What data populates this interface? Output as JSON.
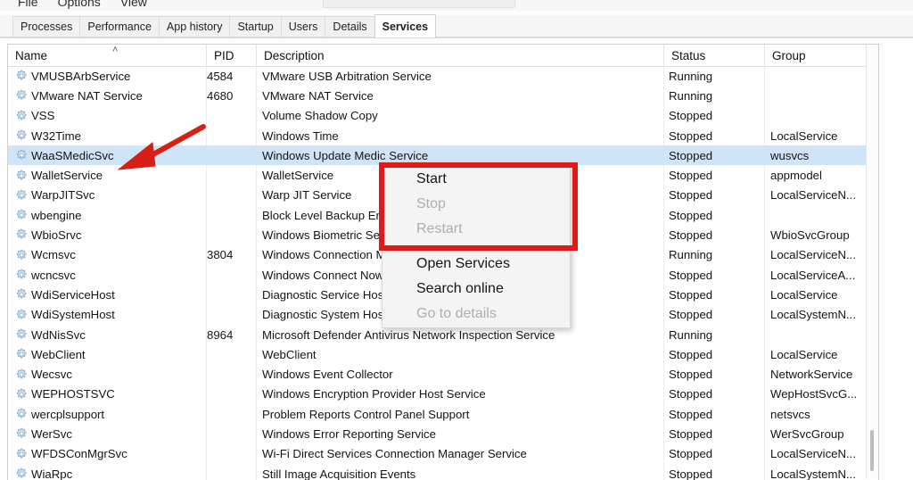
{
  "window": {
    "menubar": [
      "File",
      "Options",
      "View"
    ]
  },
  "tabs": [
    {
      "label": "Processes",
      "active": false
    },
    {
      "label": "Performance",
      "active": false
    },
    {
      "label": "App history",
      "active": false
    },
    {
      "label": "Startup",
      "active": false
    },
    {
      "label": "Users",
      "active": false
    },
    {
      "label": "Details",
      "active": false
    },
    {
      "label": "Services",
      "active": true
    }
  ],
  "columns": [
    {
      "key": "name",
      "label": "Name",
      "sorted": "asc"
    },
    {
      "key": "pid",
      "label": "PID"
    },
    {
      "key": "description",
      "label": "Description"
    },
    {
      "key": "status",
      "label": "Status"
    },
    {
      "key": "group",
      "label": "Group"
    }
  ],
  "icons": {
    "service": "gear-icon",
    "sort_ascending": "˄"
  },
  "colors": {
    "selection": "#cfe5f7",
    "annotation": "#e01b17",
    "disabled_text": "#aeaeae"
  },
  "rows": [
    {
      "name": "VMUSBArbService",
      "pid": "4584",
      "description": "VMware USB Arbitration Service",
      "status": "Running",
      "group": "",
      "selected": false
    },
    {
      "name": "VMware NAT Service",
      "pid": "4680",
      "description": "VMware NAT Service",
      "status": "Running",
      "group": "",
      "selected": false
    },
    {
      "name": "VSS",
      "pid": "",
      "description": "Volume Shadow Copy",
      "status": "Stopped",
      "group": "",
      "selected": false
    },
    {
      "name": "W32Time",
      "pid": "",
      "description": "Windows Time",
      "status": "Stopped",
      "group": "LocalService",
      "selected": false
    },
    {
      "name": "WaaSMedicSvc",
      "pid": "",
      "description": "Windows Update Medic Service",
      "status": "Stopped",
      "group": "wusvcs",
      "selected": true
    },
    {
      "name": "WalletService",
      "pid": "",
      "description": "WalletService",
      "status": "Stopped",
      "group": "appmodel",
      "selected": false
    },
    {
      "name": "WarpJITSvc",
      "pid": "",
      "description": "Warp JIT Service",
      "status": "Stopped",
      "group": "LocalServiceN...",
      "selected": false
    },
    {
      "name": "wbengine",
      "pid": "",
      "description": "Block Level Backup Engine Service",
      "status": "Stopped",
      "group": "",
      "selected": false
    },
    {
      "name": "WbioSrvc",
      "pid": "",
      "description": "Windows Biometric Service",
      "status": "Stopped",
      "group": "WbioSvcGroup",
      "selected": false
    },
    {
      "name": "Wcmsvc",
      "pid": "3804",
      "description": "Windows Connection Manager",
      "status": "Running",
      "group": "LocalServiceN...",
      "selected": false
    },
    {
      "name": "wcncsvc",
      "pid": "",
      "description": "Windows Connect Now - Config Registrar",
      "status": "Stopped",
      "group": "LocalServiceA...",
      "selected": false
    },
    {
      "name": "WdiServiceHost",
      "pid": "",
      "description": "Diagnostic Service Host",
      "status": "Stopped",
      "group": "LocalService",
      "selected": false
    },
    {
      "name": "WdiSystemHost",
      "pid": "",
      "description": "Diagnostic System Host",
      "status": "Stopped",
      "group": "LocalSystemN...",
      "selected": false
    },
    {
      "name": "WdNisSvc",
      "pid": "8964",
      "description": "Microsoft Defender Antivirus Network Inspection Service",
      "status": "Running",
      "group": "",
      "selected": false
    },
    {
      "name": "WebClient",
      "pid": "",
      "description": "WebClient",
      "status": "Stopped",
      "group": "LocalService",
      "selected": false
    },
    {
      "name": "Wecsvc",
      "pid": "",
      "description": "Windows Event Collector",
      "status": "Stopped",
      "group": "NetworkService",
      "selected": false
    },
    {
      "name": "WEPHOSTSVC",
      "pid": "",
      "description": "Windows Encryption Provider Host Service",
      "status": "Stopped",
      "group": "WepHostSvcG...",
      "selected": false
    },
    {
      "name": "wercplsupport",
      "pid": "",
      "description": "Problem Reports Control Panel Support",
      "status": "Stopped",
      "group": "netsvcs",
      "selected": false
    },
    {
      "name": "WerSvc",
      "pid": "",
      "description": "Windows Error Reporting Service",
      "status": "Stopped",
      "group": "WerSvcGroup",
      "selected": false
    },
    {
      "name": "WFDSConMgrSvc",
      "pid": "",
      "description": "Wi-Fi Direct Services Connection Manager Service",
      "status": "Stopped",
      "group": "LocalServiceN...",
      "selected": false
    },
    {
      "name": "WiaRpc",
      "pid": "",
      "description": "Still Image Acquisition Events",
      "status": "Stopped",
      "group": "LocalSystemN...",
      "selected": false
    }
  ],
  "context_menu": {
    "items": [
      {
        "label": "Start",
        "enabled": true,
        "separator_after": false
      },
      {
        "label": "Stop",
        "enabled": false,
        "separator_after": false
      },
      {
        "label": "Restart",
        "enabled": false,
        "separator_after": true
      },
      {
        "label": "Open Services",
        "enabled": true,
        "separator_after": false
      },
      {
        "label": "Search online",
        "enabled": true,
        "separator_after": false
      },
      {
        "label": "Go to details",
        "enabled": false,
        "separator_after": false
      }
    ]
  }
}
